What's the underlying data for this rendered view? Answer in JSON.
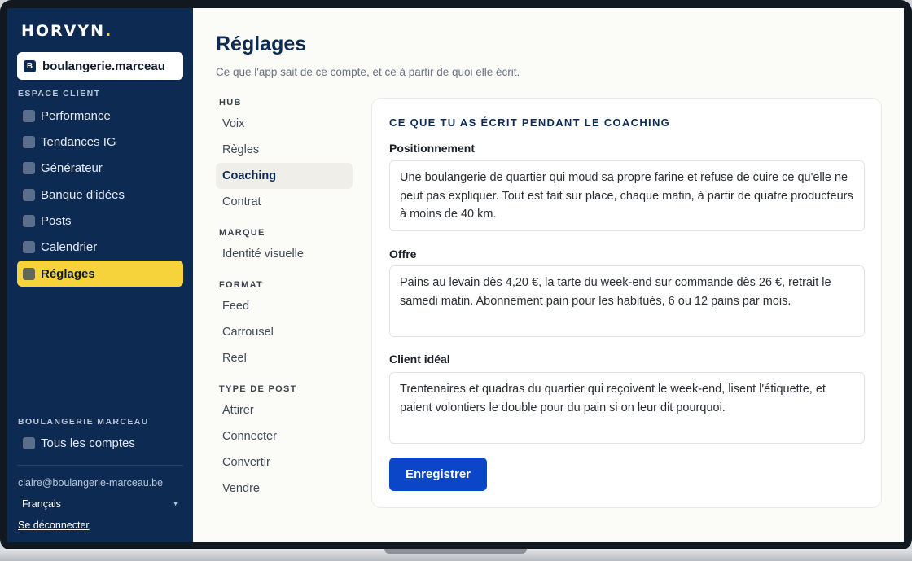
{
  "brand": {
    "name": "HORVYN",
    "dot": "."
  },
  "account": {
    "badge": "B",
    "name": "boulangerie.marceau"
  },
  "sidebar": {
    "section_label": "ESPACE CLIENT",
    "items": [
      {
        "label": "Performance",
        "active": false
      },
      {
        "label": "Tendances IG",
        "active": false
      },
      {
        "label": "Générateur",
        "active": false
      },
      {
        "label": "Banque d'idées",
        "active": false
      },
      {
        "label": "Posts",
        "active": false
      },
      {
        "label": "Calendrier",
        "active": false
      },
      {
        "label": "Réglages",
        "active": true
      }
    ],
    "workspace_label": "BOULANGERIE MARCEAU",
    "all_accounts": "Tous les comptes",
    "email": "claire@boulangerie-marceau.be",
    "language": "Français",
    "logout": "Se déconnecter"
  },
  "page": {
    "title": "Réglages",
    "subtitle": "Ce que l'app sait de ce compte, et ce à partir de quoi elle écrit."
  },
  "subnav": {
    "groups": [
      {
        "label": "HUB",
        "items": [
          "Voix",
          "Règles",
          "Coaching",
          "Contrat"
        ]
      },
      {
        "label": "MARQUE",
        "items": [
          "Identité visuelle"
        ]
      },
      {
        "label": "FORMAT",
        "items": [
          "Feed",
          "Carrousel",
          "Reel"
        ]
      },
      {
        "label": "TYPE DE POST",
        "items": [
          "Attirer",
          "Connecter",
          "Convertir",
          "Vendre"
        ]
      }
    ],
    "active": "Coaching"
  },
  "card": {
    "heading": "CE QUE TU AS ÉCRIT PENDANT LE COACHING",
    "fields": [
      {
        "label": "Positionnement",
        "value": "Une boulangerie de quartier qui moud sa propre farine et refuse de cuire ce qu'elle ne peut pas expliquer. Tout est fait sur place, chaque matin, à partir de quatre producteurs à moins de 40 km."
      },
      {
        "label": "Offre",
        "value": "Pains au levain dès 4,20 €, la tarte du week-end sur commande dès 26 €, retrait le samedi matin. Abonnement pain pour les habitués, 6 ou 12 pains par mois."
      },
      {
        "label": "Client idéal",
        "value": "Trentenaires et quadras du quartier qui reçoivent le week-end, lisent l'étiquette, et paient volontiers le double pour du pain si on leur dit pourquoi."
      }
    ],
    "save_label": "Enregistrer"
  },
  "colors": {
    "sidebar_bg": "#0c2a52",
    "accent_yellow": "#f6d33a",
    "primary_button": "#0b46c8",
    "title_navy": "#0c2a52"
  }
}
